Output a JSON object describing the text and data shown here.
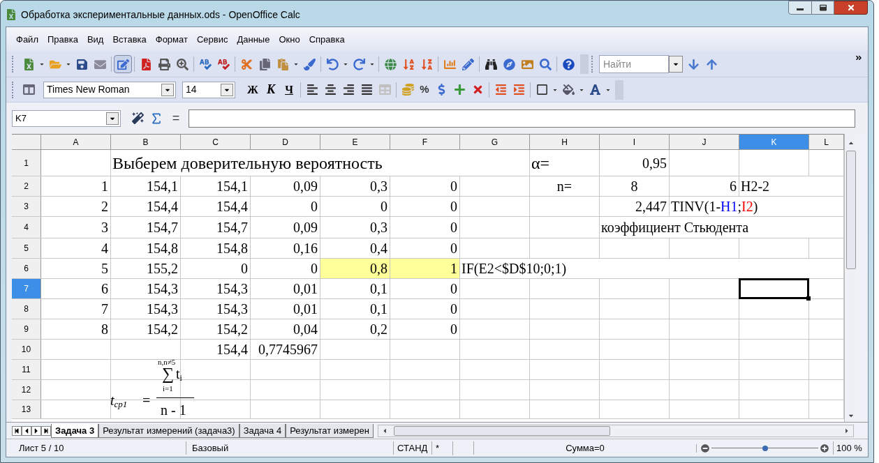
{
  "window": {
    "title": "Обработка экспериментальные данных.ods - OpenOffice Calc"
  },
  "menu": [
    "Файл",
    "Правка",
    "Вид",
    "Вставка",
    "Формат",
    "Сервис",
    "Данные",
    "Окно",
    "Справка"
  ],
  "toolbar": {
    "edit_mode_on": true,
    "find_placeholder": "Найти"
  },
  "formatting": {
    "font": "Times New Roman",
    "size": "14",
    "bold": "Ж",
    "italic": "К",
    "underline": "Ч",
    "percent": "%"
  },
  "formula_bar": {
    "cell_ref": "K7",
    "equals": "="
  },
  "columns": [
    {
      "label": "A",
      "selected": false
    },
    {
      "label": "B",
      "selected": false
    },
    {
      "label": "C",
      "selected": false
    },
    {
      "label": "D",
      "selected": false
    },
    {
      "label": "E",
      "selected": false
    },
    {
      "label": "F",
      "selected": false
    },
    {
      "label": "G",
      "selected": false
    },
    {
      "label": "H",
      "selected": false
    },
    {
      "label": "I",
      "selected": false
    },
    {
      "label": "J",
      "selected": false
    },
    {
      "label": "K",
      "selected": true
    },
    {
      "label": "L",
      "selected": false
    }
  ],
  "rows": [
    {
      "label": "1",
      "selected": false,
      "cells": [
        null,
        {
          "text": "Выберем доверительную вероятность",
          "kind": "heading",
          "highlighted": false
        },
        null,
        null,
        null,
        null,
        null,
        {
          "text": "α=",
          "kind": "heading",
          "highlighted": false
        },
        {
          "text": "0,95",
          "kind": "number",
          "highlighted": false
        },
        null,
        null,
        null
      ]
    },
    {
      "label": "2",
      "selected": false,
      "cells": [
        {
          "text": "1",
          "kind": "number",
          "highlighted": false
        },
        {
          "text": "154,1",
          "kind": "number",
          "highlighted": false
        },
        {
          "text": "154,1",
          "kind": "number",
          "highlighted": false
        },
        {
          "text": "0,09",
          "kind": "number",
          "highlighted": false
        },
        {
          "text": "0,3",
          "kind": "number",
          "highlighted": false
        },
        {
          "text": "0",
          "kind": "number",
          "highlighted": false
        },
        null,
        {
          "text": "n=",
          "kind": "centered",
          "highlighted": false
        },
        {
          "text": "8",
          "kind": "centered",
          "highlighted": false
        },
        {
          "text": "6",
          "kind": "number",
          "highlighted": false
        },
        {
          "text": "H2-2",
          "kind": "text",
          "highlighted": false
        },
        null
      ]
    },
    {
      "label": "3",
      "selected": false,
      "cells": [
        {
          "text": "2",
          "kind": "number",
          "highlighted": false
        },
        {
          "text": "154,4",
          "kind": "number",
          "highlighted": false
        },
        {
          "text": "154,4",
          "kind": "number",
          "highlighted": false
        },
        {
          "text": "0",
          "kind": "number",
          "highlighted": false
        },
        {
          "text": "0",
          "kind": "number",
          "highlighted": false
        },
        {
          "text": "0",
          "kind": "number",
          "highlighted": false
        },
        null,
        null,
        {
          "text": "2,447",
          "kind": "number",
          "highlighted": false
        },
        {
          "kind": "text",
          "highlighted": false,
          "parts": [
            {
              "text": "TINV(1-"
            },
            {
              "text": "H1",
              "color": "#0000ff"
            },
            {
              "text": ";"
            },
            {
              "text": "I2",
              "color": "#ff0000"
            },
            {
              "text": ")"
            }
          ]
        },
        null,
        null
      ]
    },
    {
      "label": "4",
      "selected": false,
      "cells": [
        {
          "text": "3",
          "kind": "number",
          "highlighted": false
        },
        {
          "text": "154,7",
          "kind": "number",
          "highlighted": false
        },
        {
          "text": "154,7",
          "kind": "number",
          "highlighted": false
        },
        {
          "text": "0,09",
          "kind": "number",
          "highlighted": false
        },
        {
          "text": "0,3",
          "kind": "number",
          "highlighted": false
        },
        {
          "text": "0",
          "kind": "number",
          "highlighted": false
        },
        null,
        null,
        {
          "text": "коэффициент Стьюдента",
          "kind": "text",
          "highlighted": false
        },
        null,
        null,
        null
      ]
    },
    {
      "label": "5",
      "selected": false,
      "cells": [
        {
          "text": "4",
          "kind": "number",
          "highlighted": false
        },
        {
          "text": "154,8",
          "kind": "number",
          "highlighted": false
        },
        {
          "text": "154,8",
          "kind": "number",
          "highlighted": false
        },
        {
          "text": "0,16",
          "kind": "number",
          "highlighted": false
        },
        {
          "text": "0,4",
          "kind": "number",
          "highlighted": false
        },
        {
          "text": "0",
          "kind": "number",
          "highlighted": false
        },
        null,
        null,
        null,
        null,
        null,
        null
      ]
    },
    {
      "label": "6",
      "selected": false,
      "cells": [
        {
          "text": "5",
          "kind": "number",
          "highlighted": false
        },
        {
          "text": "155,2",
          "kind": "number",
          "highlighted": false
        },
        {
          "text": "0",
          "kind": "number",
          "highlighted": false
        },
        {
          "text": "0",
          "kind": "number",
          "highlighted": false
        },
        {
          "text": "0,8",
          "kind": "number",
          "highlighted": true
        },
        {
          "text": "1",
          "kind": "number",
          "highlighted": true
        },
        {
          "text": "IF(E2<$D$10;0;1)",
          "kind": "text",
          "highlighted": false
        },
        null,
        null,
        null,
        null,
        null
      ]
    },
    {
      "label": "7",
      "selected": true,
      "cells": [
        {
          "text": "6",
          "kind": "number",
          "highlighted": false
        },
        {
          "text": "154,3",
          "kind": "number",
          "highlighted": false
        },
        {
          "text": "154,3",
          "kind": "number",
          "highlighted": false
        },
        {
          "text": "0,01",
          "kind": "number",
          "highlighted": false
        },
        {
          "text": "0,1",
          "kind": "number",
          "highlighted": false
        },
        {
          "text": "0",
          "kind": "number",
          "highlighted": false
        },
        null,
        null,
        null,
        null,
        null,
        null
      ]
    },
    {
      "label": "8",
      "selected": false,
      "cells": [
        {
          "text": "7",
          "kind": "number",
          "highlighted": false
        },
        {
          "text": "154,3",
          "kind": "number",
          "highlighted": false
        },
        {
          "text": "154,3",
          "kind": "number",
          "highlighted": false
        },
        {
          "text": "0,01",
          "kind": "number",
          "highlighted": false
        },
        {
          "text": "0,1",
          "kind": "number",
          "highlighted": false
        },
        {
          "text": "0",
          "kind": "number",
          "highlighted": false
        },
        null,
        null,
        null,
        null,
        null,
        null
      ]
    },
    {
      "label": "9",
      "selected": false,
      "cells": [
        {
          "text": "8",
          "kind": "number",
          "highlighted": false
        },
        {
          "text": "154,2",
          "kind": "number",
          "highlighted": false
        },
        {
          "text": "154,2",
          "kind": "number",
          "highlighted": false
        },
        {
          "text": "0,04",
          "kind": "number",
          "highlighted": false
        },
        {
          "text": "0,2",
          "kind": "number",
          "highlighted": false
        },
        {
          "text": "0",
          "kind": "number",
          "highlighted": false
        },
        null,
        null,
        null,
        null,
        null,
        null
      ]
    },
    {
      "label": "10",
      "selected": false,
      "cells": [
        null,
        null,
        {
          "text": "154,4",
          "kind": "number",
          "highlighted": false
        },
        {
          "text": "0,7745967",
          "kind": "number",
          "highlighted": false
        },
        null,
        null,
        null,
        null,
        null,
        null,
        null,
        null
      ]
    },
    {
      "label": "11",
      "selected": false,
      "cells": [
        null,
        null,
        null,
        null,
        null,
        null,
        null,
        null,
        null,
        null,
        null,
        null
      ]
    },
    {
      "label": "12",
      "selected": false,
      "cells": [
        null,
        null,
        null,
        null,
        null,
        null,
        null,
        null,
        null,
        null,
        null,
        null
      ]
    },
    {
      "label": "13",
      "selected": false,
      "cells": [
        null,
        null,
        null,
        null,
        null,
        null,
        null,
        null,
        null,
        null,
        null,
        null
      ]
    }
  ],
  "formula": {
    "lhs": "t",
    "lhs_sub": "cp1",
    "equals": "=",
    "upper": "n,n≠5",
    "sum": "∑",
    "term": "t",
    "term_sub": "i",
    "lower": "i=1",
    "denominator": "n - 1"
  },
  "sheet_tabs": [
    {
      "label": "Задача 3",
      "selected": true
    },
    {
      "label": "Результат измерений (задача3)",
      "selected": false
    },
    {
      "label": "Задача 4",
      "selected": false
    },
    {
      "label": "Результат измерен",
      "selected": false
    }
  ],
  "status_bar": {
    "sheet": "Лист 5 / 10",
    "style": "Базовый",
    "mode": "СТАНД",
    "modified": "*",
    "sum": "Сумма=0",
    "zoom": {
      "level": 0.5,
      "reading": "100 %"
    }
  }
}
